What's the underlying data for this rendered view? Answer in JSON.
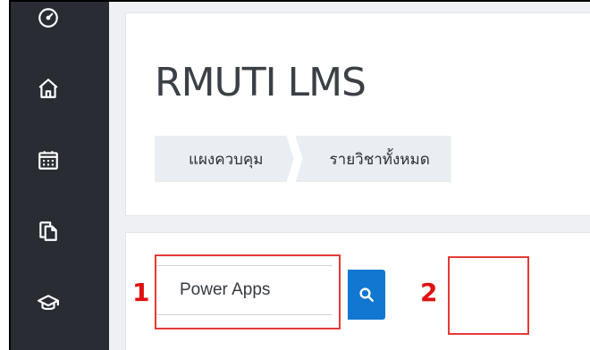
{
  "sidebar": {
    "items": [
      {
        "icon": "dashboard-gauge-icon"
      },
      {
        "icon": "home-icon"
      },
      {
        "icon": "calendar-icon"
      },
      {
        "icon": "copy-pages-icon"
      },
      {
        "icon": "graduation-cap-icon"
      }
    ]
  },
  "header": {
    "site_title": "RMUTI LMS",
    "breadcrumb": [
      "แผงควบคุม",
      "รายวิชาทั้งหมด"
    ]
  },
  "search": {
    "value": "Power Apps",
    "button_icon": "search-icon"
  },
  "annotations": [
    {
      "label": "1",
      "color": "#e01010"
    },
    {
      "label": "2",
      "color": "#e01010"
    }
  ],
  "colors": {
    "sidebar": "#292d33",
    "accent": "#1177d1",
    "annotation": "#e53935"
  }
}
